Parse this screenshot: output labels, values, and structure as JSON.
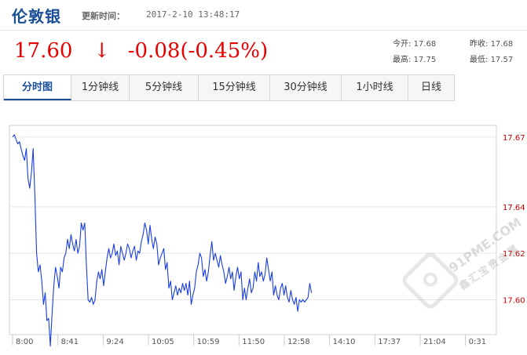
{
  "header": {
    "title": "伦敦银",
    "update_label": "更新时间：",
    "update_time": "2017-2-10  13:48:17"
  },
  "quote": {
    "price": "17.60",
    "arrow": "↓",
    "change": "-0.08(-0.45%)",
    "open_label": "今开:",
    "open": "17.68",
    "prev_close_label": "昨收:",
    "prev_close": "17.68",
    "high_label": "最高:",
    "high": "17.75",
    "low_label": "最低:",
    "low": "17.57"
  },
  "tabs": [
    {
      "label": "分时图",
      "active": true
    },
    {
      "label": "1分钟线",
      "active": false
    },
    {
      "label": "5分钟线",
      "active": false
    },
    {
      "label": "15分钟线",
      "active": false
    },
    {
      "label": "30分钟线",
      "active": false
    },
    {
      "label": "1小时线",
      "active": false
    },
    {
      "label": "日线",
      "active": false
    }
  ],
  "watermark": {
    "text": "91PME.COM",
    "subtext": "鑫汇宝贵金属"
  },
  "colors": {
    "line": "#1a3ee0",
    "price_text": "#e60000",
    "title": "#1a4f97",
    "grid": "#e5e5e5",
    "axis_label": "#cc0000"
  },
  "chart_data": {
    "type": "line",
    "title": "",
    "xlabel": "",
    "ylabel": "",
    "x_ticks": [
      "8:00",
      "8:41",
      "9:24",
      "10:05",
      "10:59",
      "11:50",
      "12:58",
      "14:10",
      "17:37",
      "21:04",
      "0:31"
    ],
    "y_ticks": [
      "17.67",
      "17.64",
      "17.62",
      "17.60"
    ],
    "ylim": [
      17.585,
      17.675
    ],
    "grid": true,
    "series": [
      {
        "values": [
          17.67,
          17.671,
          17.669,
          17.667,
          17.668,
          17.665,
          17.662,
          17.66,
          17.665,
          17.652,
          17.648,
          17.655,
          17.665,
          17.645,
          17.62,
          17.612,
          17.615,
          17.608,
          17.598,
          17.603,
          17.591,
          17.592,
          17.58,
          17.594,
          17.606,
          17.614,
          17.61,
          17.605,
          17.614,
          17.612,
          17.618,
          17.62,
          17.626,
          17.622,
          17.628,
          17.624,
          17.621,
          17.626,
          17.62,
          17.623,
          17.633,
          17.63,
          17.633,
          17.615,
          17.6,
          17.599,
          17.601,
          17.598,
          17.6,
          17.608,
          17.612,
          17.609,
          17.613,
          17.606,
          17.612,
          17.618,
          17.622,
          17.618,
          17.62,
          17.624,
          17.619,
          17.621,
          17.615,
          17.623,
          17.62,
          17.617,
          17.62,
          17.624,
          17.622,
          17.618,
          17.621,
          17.623,
          17.617,
          17.621,
          17.62,
          17.625,
          17.628,
          17.633,
          17.63,
          17.624,
          17.632,
          17.626,
          17.622,
          17.627,
          17.624,
          17.615,
          17.618,
          17.62,
          17.622,
          17.613,
          17.616,
          17.605,
          17.608,
          17.6,
          17.603,
          17.606,
          17.602,
          17.605,
          17.603,
          17.607,
          17.604,
          17.607,
          17.602,
          17.608,
          17.598,
          17.602,
          17.605,
          17.612,
          17.615,
          17.62,
          17.618,
          17.61,
          17.613,
          17.608,
          17.612,
          17.619,
          17.625,
          17.617,
          17.62,
          17.617,
          17.614,
          17.619,
          17.615,
          17.612,
          17.607,
          17.61,
          17.614,
          17.609,
          17.612,
          17.604,
          17.61,
          17.614,
          17.609,
          17.612,
          17.6,
          17.605,
          17.6,
          17.605,
          17.609,
          17.603,
          17.605,
          17.612,
          17.608,
          17.616,
          17.61,
          17.612,
          17.608,
          17.611,
          17.618,
          17.613,
          17.608,
          17.612,
          17.602,
          17.606,
          17.602,
          17.6,
          17.605,
          17.607,
          17.602,
          17.606,
          17.601,
          17.599,
          17.604,
          17.6,
          17.598,
          17.601,
          17.595,
          17.6,
          17.599,
          17.6,
          17.599,
          17.6,
          17.601,
          17.607,
          17.603
        ]
      }
    ]
  }
}
